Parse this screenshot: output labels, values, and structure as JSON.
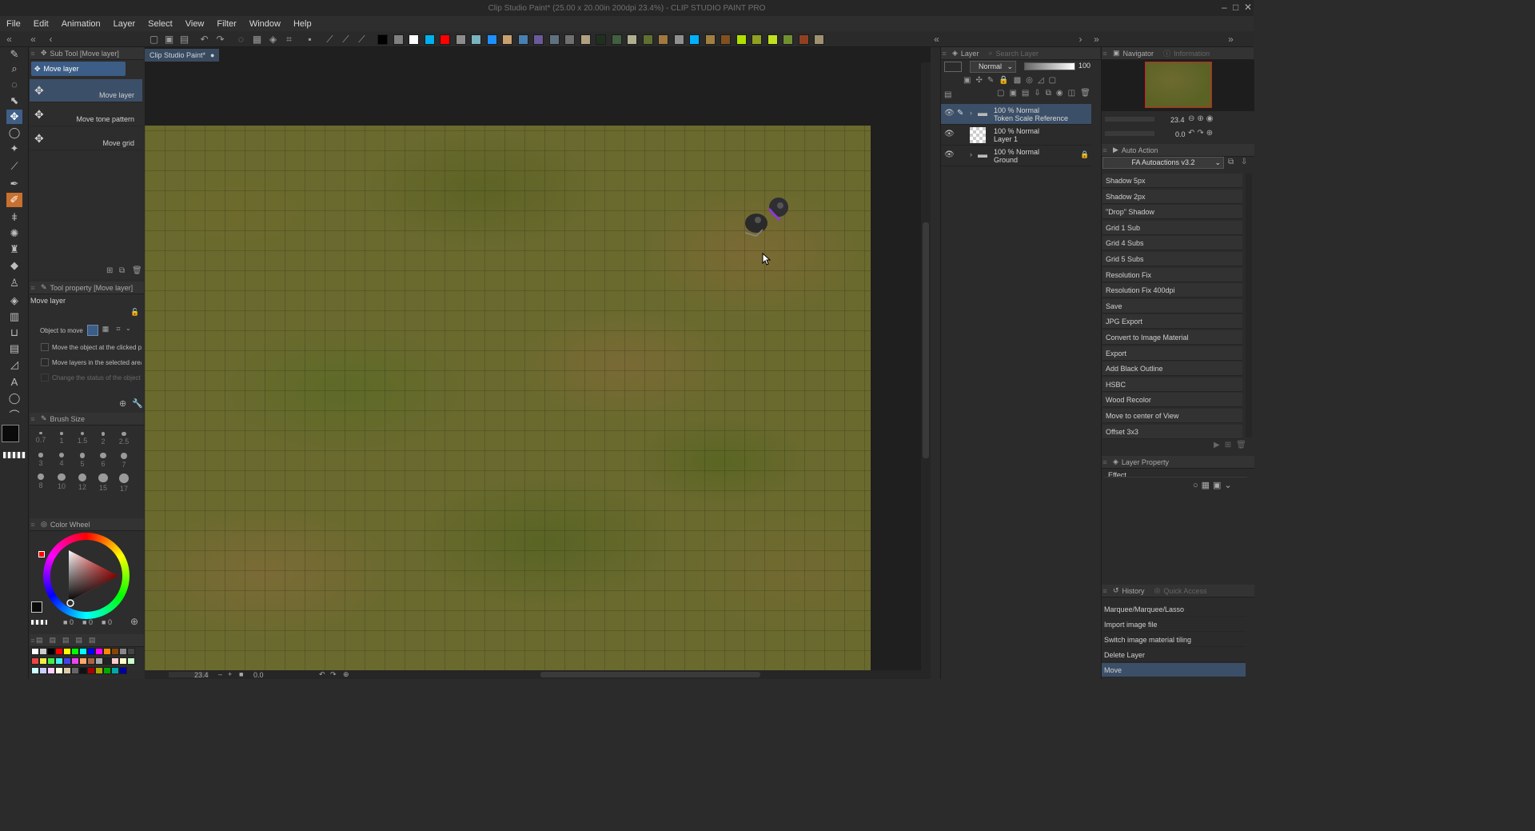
{
  "title": "Clip Studio Paint* (25.00 x 20.00in 200dpi 23.4%) - CLIP STUDIO PAINT PRO",
  "menu": [
    "File",
    "Edit",
    "Animation",
    "Layer",
    "Select",
    "View",
    "Filter",
    "Window",
    "Help"
  ],
  "swatches": [
    "#000000",
    "#808080",
    "#ffffff",
    "#00b0f0",
    "#ff0000",
    "#8c8c8c",
    "#7ab2bd",
    "#1e90ff",
    "#c8a070",
    "#4a80b0",
    "#6a5a9a",
    "#607080",
    "#707070",
    "#b0a080",
    "#203020",
    "#406040",
    "#b0b090",
    "#607030",
    "#a07840",
    "#909090",
    "#00b0ff",
    "#a08040",
    "#805020",
    "#b0e000",
    "#90a020",
    "#c0e020",
    "#709030",
    "#904020",
    "#a09070"
  ],
  "subtool": {
    "header": "Sub Tool [Move layer]",
    "group": "Move layer",
    "items": [
      "Move layer",
      "Move tone pattern",
      "Move grid"
    ]
  },
  "toolprop": {
    "header": "Tool property [Move layer]",
    "name": "Move layer",
    "object_label": "Object to move",
    "checks": [
      "Move the object at the clicked po",
      "Move layers in the selected area",
      "Change the status of the object to"
    ]
  },
  "brush": {
    "header": "Brush Size",
    "sizes": [
      "0.7",
      "1",
      "1.5",
      "2",
      "2.5",
      "3",
      "4",
      "5",
      "6",
      "7",
      "8",
      "10",
      "12",
      "15",
      "17"
    ]
  },
  "color": {
    "header": "Color Wheel",
    "fg": "#0a0a0a",
    "bg": "#ffffff",
    "v1": "0",
    "v2": "0",
    "v3": "0"
  },
  "doc_tab": "Clip Studio Paint*",
  "status": {
    "zoom": "23.4",
    "rotation": "0.0"
  },
  "layers": {
    "header": "Layer",
    "search": "Search Layer",
    "blend": "Normal",
    "opacity": "100",
    "rows": [
      {
        "t1": "100 % Normal",
        "t2": "Token Scale Reference"
      },
      {
        "t1": "100 % Normal",
        "t2": "Layer 1"
      },
      {
        "t1": "100 % Normal",
        "t2": "Ground"
      }
    ]
  },
  "navigator": {
    "tab1": "Navigator",
    "tab2": "Information",
    "zoom": "23.4",
    "angle": "0.0"
  },
  "autoaction": {
    "header": "Auto Action",
    "set": "FA Autoactions v3.2",
    "items": [
      "Shadow 5px",
      "Shadow 2px",
      "\"Drop\" Shadow",
      "Grid 1 Sub",
      "Grid 4 Subs",
      "Grid 5 Subs",
      "Resolution Fix",
      "Resolution Fix 400dpi",
      "Save",
      "JPG Export",
      "Convert to Image Material",
      "Export",
      "Add Black Outline",
      "HSBC",
      "Wood Recolor",
      "Move to center of View",
      "Offset 3x3"
    ]
  },
  "layerprop": {
    "header": "Layer Property",
    "effect": "Effect"
  },
  "history": {
    "tab1": "History",
    "tab2": "Quick Access",
    "items": [
      "Marquee/Marquee/Lasso",
      "Import image file",
      "Switch image material tiling",
      "Delete Layer",
      "Move"
    ]
  }
}
